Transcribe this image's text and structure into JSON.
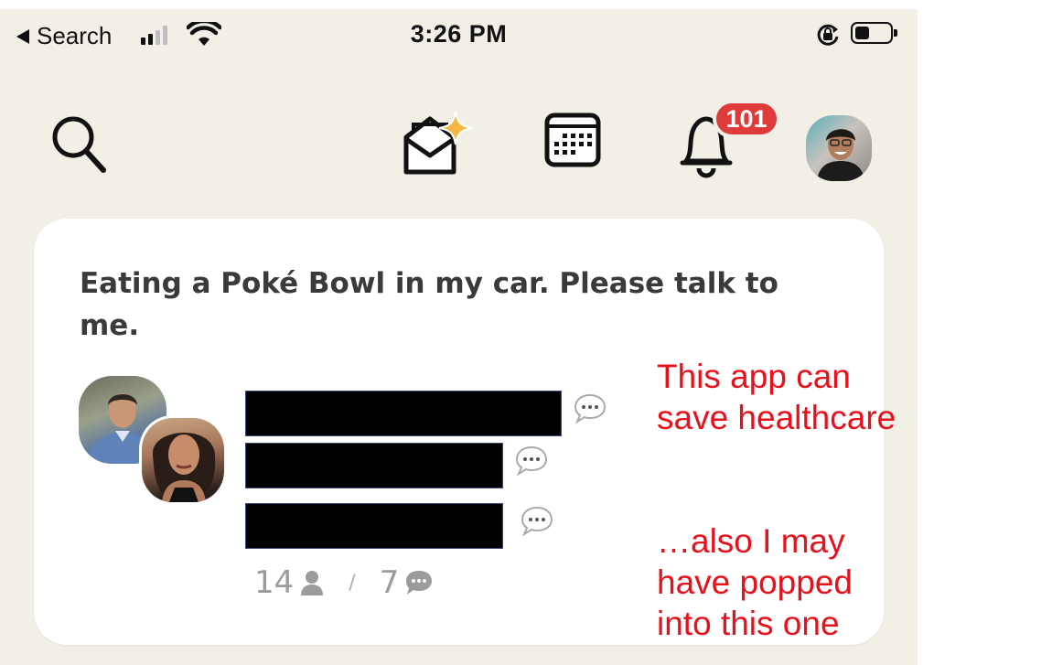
{
  "status_bar": {
    "back_label": "Search",
    "time": "3:26 PM"
  },
  "nav": {
    "notifications_count": "101",
    "icons": [
      "search-icon",
      "invite-icon",
      "calendar-icon",
      "bell-icon"
    ]
  },
  "room": {
    "title": "Eating a Poké Bowl in my car. Please talk to me.",
    "listener_count": "14",
    "speaker_count": "7"
  },
  "annotations": {
    "primary_lines": [
      "This app can",
      "save healthcare"
    ],
    "secondary_lines": [
      "…also I may",
      "have popped",
      "into this one"
    ]
  },
  "colors": {
    "background": "#f1efe6",
    "card": "#ffffff",
    "badge": "#e03b3b",
    "annotation": "#e8111b",
    "stats_text": "#9b9b9b"
  }
}
